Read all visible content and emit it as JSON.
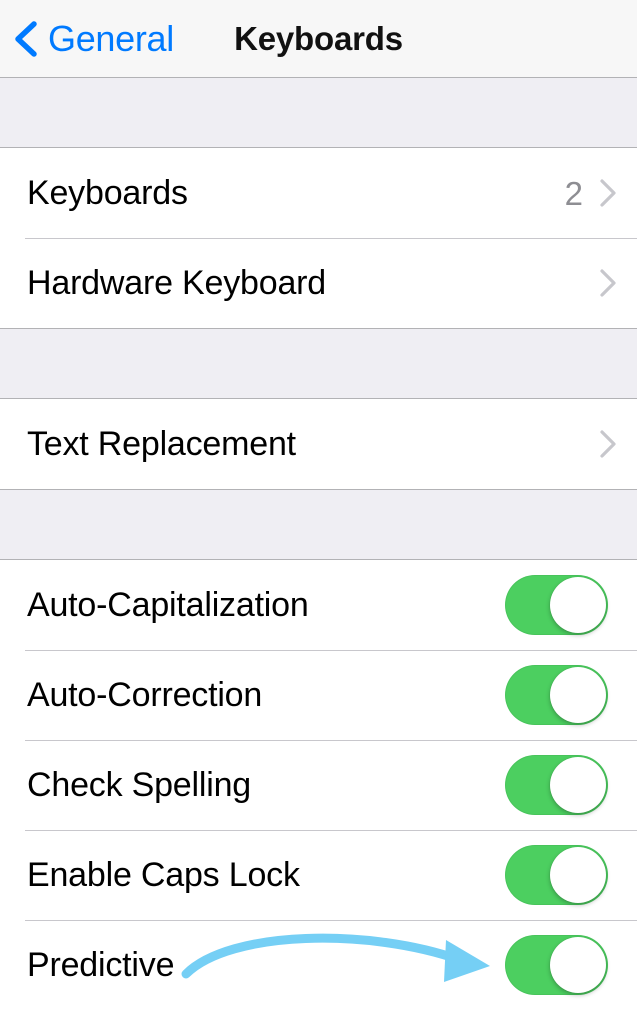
{
  "navbar": {
    "back_label": "General",
    "back_icon": "chevron-left-icon",
    "title": "Keyboards"
  },
  "colors": {
    "accent_blue": "#007aff",
    "switch_on_green": "#4ccf60",
    "value_gray": "#8e8e93",
    "chevron_gray": "#c7c7cc",
    "section_bg": "#efeef3",
    "annotation_blue": "#75cff5"
  },
  "sections": [
    {
      "rows": [
        {
          "label": "Keyboards",
          "value": "2",
          "accessory": "disclosure"
        },
        {
          "label": "Hardware Keyboard",
          "value": "",
          "accessory": "disclosure"
        }
      ]
    },
    {
      "rows": [
        {
          "label": "Text Replacement",
          "value": "",
          "accessory": "disclosure"
        }
      ]
    },
    {
      "rows": [
        {
          "label": "Auto-Capitalization",
          "value": "",
          "accessory": "switch",
          "switch_on": true
        },
        {
          "label": "Auto-Correction",
          "value": "",
          "accessory": "switch",
          "switch_on": true
        },
        {
          "label": "Check Spelling",
          "value": "",
          "accessory": "switch",
          "switch_on": true
        },
        {
          "label": "Enable Caps Lock",
          "value": "",
          "accessory": "switch",
          "switch_on": true
        },
        {
          "label": "Predictive",
          "value": "",
          "accessory": "switch",
          "switch_on": true
        }
      ]
    }
  ],
  "annotation": {
    "type": "curved-arrow",
    "points_to": "predictive-switch"
  }
}
